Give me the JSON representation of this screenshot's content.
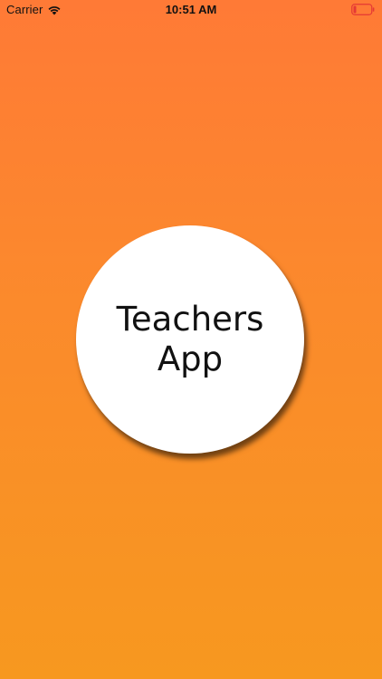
{
  "status_bar": {
    "carrier": "Carrier",
    "time": "10:51 AM",
    "icons": {
      "wifi": "wifi-icon",
      "battery": "battery-low-icon"
    },
    "battery_color": "#e53935"
  },
  "splash": {
    "title": "Teachers App"
  },
  "colors": {
    "background_top": "#ff7a36",
    "background_bottom": "#f7981f",
    "circle": "#ffffff"
  }
}
